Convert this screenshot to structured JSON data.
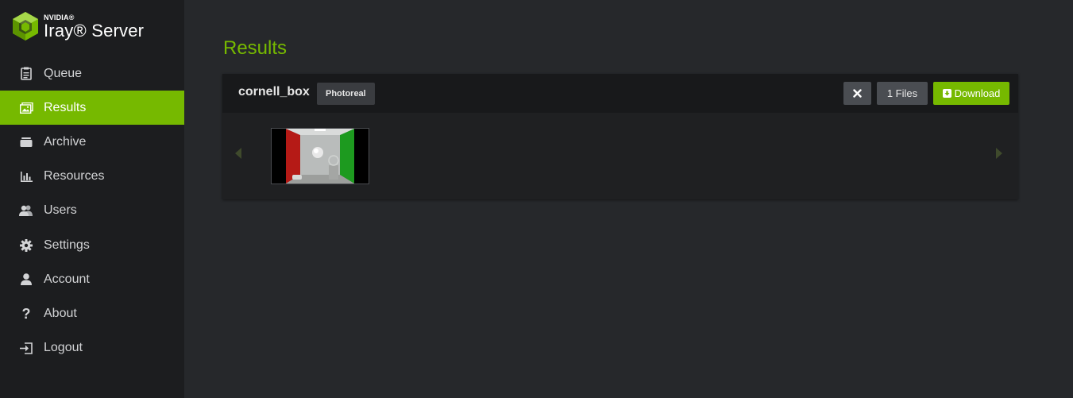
{
  "brand": {
    "company": "NVIDIA®",
    "product": "Iray® Server"
  },
  "sidebar": {
    "items": [
      {
        "label": "Queue",
        "icon": "clipboard-icon",
        "active": false
      },
      {
        "label": "Results",
        "icon": "image-icon",
        "active": true
      },
      {
        "label": "Archive",
        "icon": "archive-icon",
        "active": false
      },
      {
        "label": "Resources",
        "icon": "bar-chart-icon",
        "active": false
      },
      {
        "label": "Users",
        "icon": "users-icon",
        "active": false
      },
      {
        "label": "Settings",
        "icon": "gear-icon",
        "active": false
      },
      {
        "label": "Account",
        "icon": "user-icon",
        "active": false
      },
      {
        "label": "About",
        "icon": "question-icon",
        "active": false
      },
      {
        "label": "Logout",
        "icon": "logout-icon",
        "active": false
      }
    ]
  },
  "main": {
    "title": "Results",
    "results": [
      {
        "name": "cornell_box",
        "tag": "Photoreal",
        "files_label": "1 Files",
        "download_label": "Download",
        "close_icon": "close-icon"
      }
    ]
  },
  "colors": {
    "accent": "#76b900",
    "sidebar_bg": "#1c1d1f",
    "main_bg": "#26282b",
    "card_bg": "#1f2022",
    "card_header_bg": "#18191b",
    "button_gray": "#4a4d52"
  }
}
